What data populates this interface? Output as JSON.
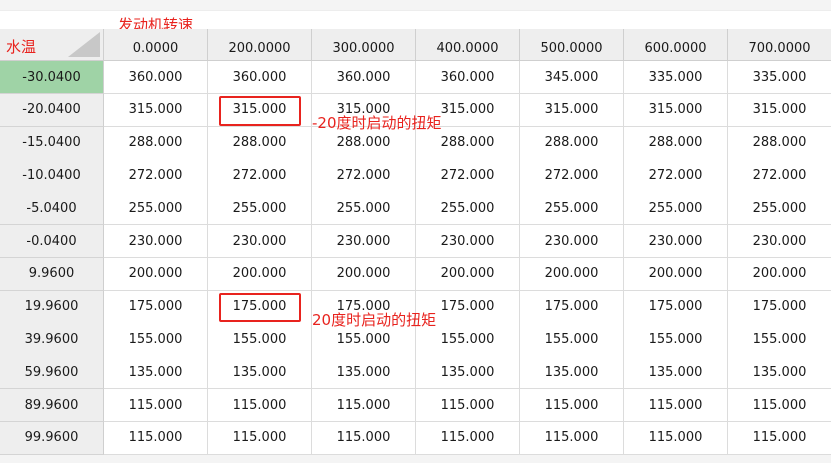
{
  "table": {
    "corner_label": "水温",
    "axis_label": "发动机转速",
    "columns": [
      "0.0000",
      "200.0000",
      "300.0000",
      "400.0000",
      "500.0000",
      "600.0000",
      "700.0000"
    ],
    "rows": [
      {
        "temp": "-30.0400",
        "selected": true,
        "values": [
          "360.000",
          "360.000",
          "360.000",
          "360.000",
          "345.000",
          "335.000",
          "335.000"
        ]
      },
      {
        "temp": "-20.0400",
        "selected": false,
        "values": [
          "315.000",
          "315.000",
          "315.000",
          "315.000",
          "315.000",
          "315.000",
          "315.000"
        ]
      },
      {
        "temp": "-15.0400",
        "selected": false,
        "values": [
          "288.000",
          "288.000",
          "288.000",
          "288.000",
          "288.000",
          "288.000",
          "288.000"
        ]
      },
      {
        "temp": "-10.0400",
        "selected": false,
        "values": [
          "272.000",
          "272.000",
          "272.000",
          "272.000",
          "272.000",
          "272.000",
          "272.000"
        ]
      },
      {
        "temp": "-5.0400",
        "selected": false,
        "values": [
          "255.000",
          "255.000",
          "255.000",
          "255.000",
          "255.000",
          "255.000",
          "255.000"
        ]
      },
      {
        "temp": "-0.0400",
        "selected": false,
        "values": [
          "230.000",
          "230.000",
          "230.000",
          "230.000",
          "230.000",
          "230.000",
          "230.000"
        ]
      },
      {
        "temp": "9.9600",
        "selected": false,
        "values": [
          "200.000",
          "200.000",
          "200.000",
          "200.000",
          "200.000",
          "200.000",
          "200.000"
        ]
      },
      {
        "temp": "19.9600",
        "selected": false,
        "values": [
          "175.000",
          "175.000",
          "175.000",
          "175.000",
          "175.000",
          "175.000",
          "175.000"
        ]
      },
      {
        "temp": "39.9600",
        "selected": false,
        "values": [
          "155.000",
          "155.000",
          "155.000",
          "155.000",
          "155.000",
          "155.000",
          "155.000"
        ]
      },
      {
        "temp": "59.9600",
        "selected": false,
        "values": [
          "135.000",
          "135.000",
          "135.000",
          "135.000",
          "135.000",
          "135.000",
          "135.000"
        ]
      },
      {
        "temp": "89.9600",
        "selected": false,
        "values": [
          "115.000",
          "115.000",
          "115.000",
          "115.000",
          "115.000",
          "115.000",
          "115.000"
        ]
      },
      {
        "temp": "99.9600",
        "selected": false,
        "values": [
          "115.000",
          "115.000",
          "115.000",
          "115.000",
          "115.000",
          "115.000",
          "115.000"
        ]
      }
    ]
  },
  "annotations": [
    {
      "text": "-20度时启动的扭矩",
      "row": 1,
      "col": 1
    },
    {
      "text": "20度时启动的扭矩",
      "row": 7,
      "col": 1
    }
  ],
  "colors": {
    "annotation": "#e8231e",
    "selected_row_header": "#9fd3a6",
    "header_bg": "#eeeeee"
  }
}
